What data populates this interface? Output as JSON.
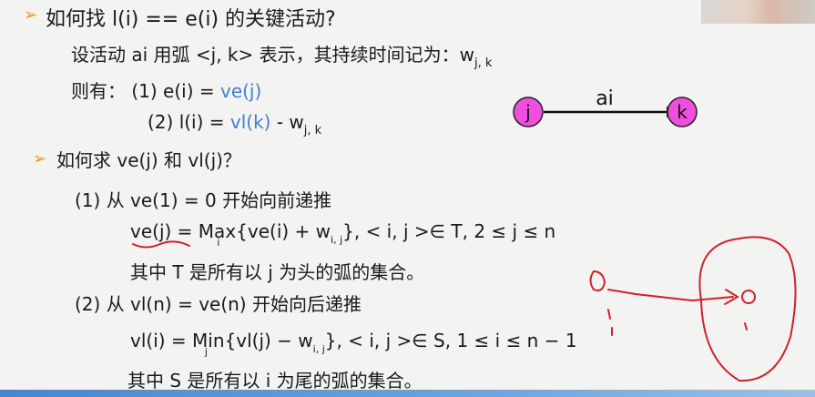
{
  "lines": {
    "q1_bullet": "➢",
    "q1": "如何找 l(i) == e(i) 的关键活动?",
    "desc_prefix": "设活动 ai 用弧 <j, k> 表示，其持续时间记为：w",
    "desc_sub": "j, k",
    "then_prefix": "则有：  (1)   e(i) = ",
    "then_blue": "ve(j)",
    "line2_prefix": "(2)   l(i) = ",
    "line2_blue": "vl(k)",
    "line2_suffix": " - w",
    "line2_sub": "j, k",
    "q2_bullet": "➢",
    "q2": "如何求 ve(j) 和 vl(j)？",
    "step1": "(1)   从 ve(1) = 0 开始向前递推",
    "f1_lhs": "ve(j)",
    "f1_eq": " = ",
    "f1_ma": "Ma",
    "f1_under": "i",
    "f1_x": "x",
    "f1_body": "{ve(i) + w",
    "f1_sub": "i, j",
    "f1_tail": "},  < i, j >∈  T,  2 ≤ j ≤ n",
    "note1": "其中 T 是所有以  j 为头的弧的集合。",
    "step2": "(2)   从 vl(n) = ve(n) 开始向后递推",
    "f2_lhs": "vl(i)",
    "f2_eq": " = ",
    "f2_mi": "Mi",
    "f2_under": "j",
    "f2_n": "n",
    "f2_body": "{vl(j) − w",
    "f2_sub": "i, j",
    "f2_tail": "},     < i, j >∈  S,  1 ≤ i ≤ n − 1",
    "note2": "其中 S 是所有以  i 为尾的弧的集合。"
  },
  "diagram": {
    "node_j": "j",
    "node_k": "k",
    "edge_label": "ai"
  },
  "colors": {
    "accent_orange": "#e8961e",
    "blue_text": "#3f7fd0",
    "node_fill": "#f04ee0",
    "red_ink": "#d0202a"
  }
}
